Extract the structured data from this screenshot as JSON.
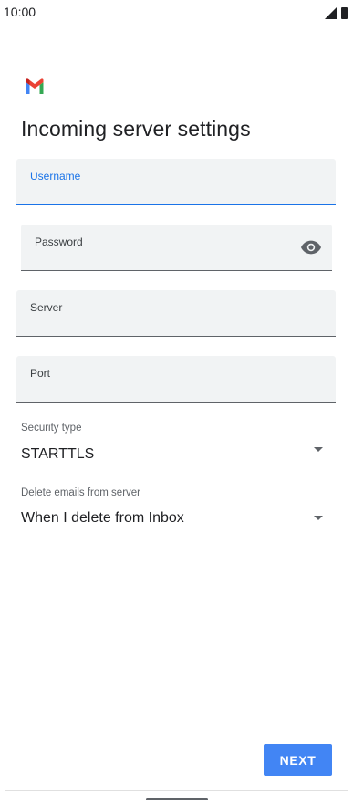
{
  "status_bar": {
    "time": "10:00",
    "icons": [
      "signal-icon",
      "battery-icon"
    ]
  },
  "header": {
    "logo": "gmail-logo",
    "title": "Incoming server settings"
  },
  "form": {
    "username": {
      "label": "Username",
      "value": "",
      "focused": true
    },
    "password": {
      "label": "Password",
      "value": "",
      "icon": "eye-icon"
    },
    "server": {
      "label": "Server",
      "value": ""
    },
    "port": {
      "label": "Port",
      "value": ""
    },
    "security_type": {
      "label": "Security type",
      "value": "STARTTLS"
    },
    "delete_emails": {
      "label": "Delete emails from server",
      "value": "When I delete from Inbox"
    }
  },
  "actions": {
    "next_label": "NEXT"
  },
  "colors": {
    "accent": "#1a73e8",
    "button": "#4285f4",
    "field_bg": "#f1f3f4",
    "text": "#202124",
    "secondary_text": "#5f6368"
  }
}
